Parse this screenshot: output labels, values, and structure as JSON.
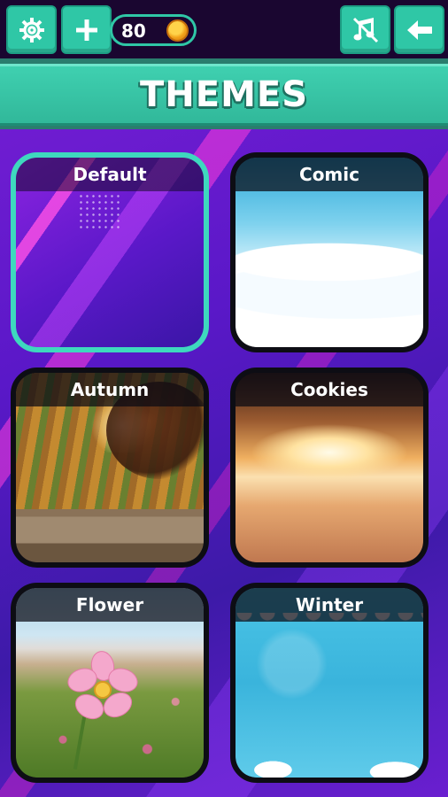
{
  "topbar": {
    "settings_icon": "gear-icon",
    "add_icon": "plus-icon",
    "coins": "80",
    "coin_icon": "coin-icon",
    "music_icon": "music-off-icon",
    "back_icon": "arrow-left-icon"
  },
  "header": {
    "title": "THEMES"
  },
  "themes": [
    {
      "label": "Default",
      "selected": true
    },
    {
      "label": "Comic",
      "selected": false
    },
    {
      "label": "Autumn",
      "selected": false
    },
    {
      "label": "Cookies",
      "selected": false
    },
    {
      "label": "Flower",
      "selected": false
    },
    {
      "label": "Winter",
      "selected": false
    }
  ],
  "colors": {
    "accent": "#2fc7a6",
    "selected_border": "#3ed8be",
    "background": "#5a18c8"
  }
}
